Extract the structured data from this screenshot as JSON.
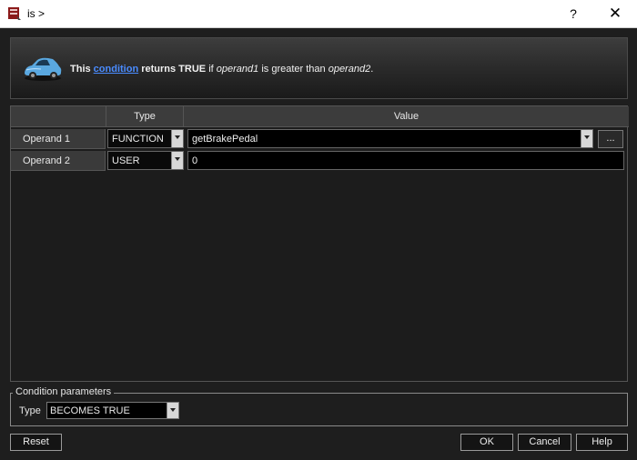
{
  "window": {
    "title": "is >",
    "help_label": "?",
    "close_label": "✕"
  },
  "banner": {
    "text_prefix": "This ",
    "link_text": "condition",
    "text_mid": " returns TRUE",
    "text_if": " if ",
    "operand1": "operand1",
    "text_greater": " is greater than ",
    "operand2": "operand2",
    "text_end": ".",
    "icon": "car-icon"
  },
  "grid": {
    "headers": {
      "type": "Type",
      "value": "Value"
    },
    "rows": [
      {
        "label": "Operand 1",
        "type": "FUNCTION",
        "value": "getBrakePedal",
        "has_dropdown": true,
        "has_browse": true
      },
      {
        "label": "Operand 2",
        "type": "USER",
        "value": "0",
        "has_dropdown": false,
        "has_browse": false
      }
    ],
    "browse_label": "..."
  },
  "condition_parameters": {
    "legend": "Condition parameters",
    "type_label": "Type",
    "type_value": "BECOMES TRUE"
  },
  "buttons": {
    "reset": "Reset",
    "ok": "OK",
    "cancel": "Cancel",
    "help": "Help"
  }
}
